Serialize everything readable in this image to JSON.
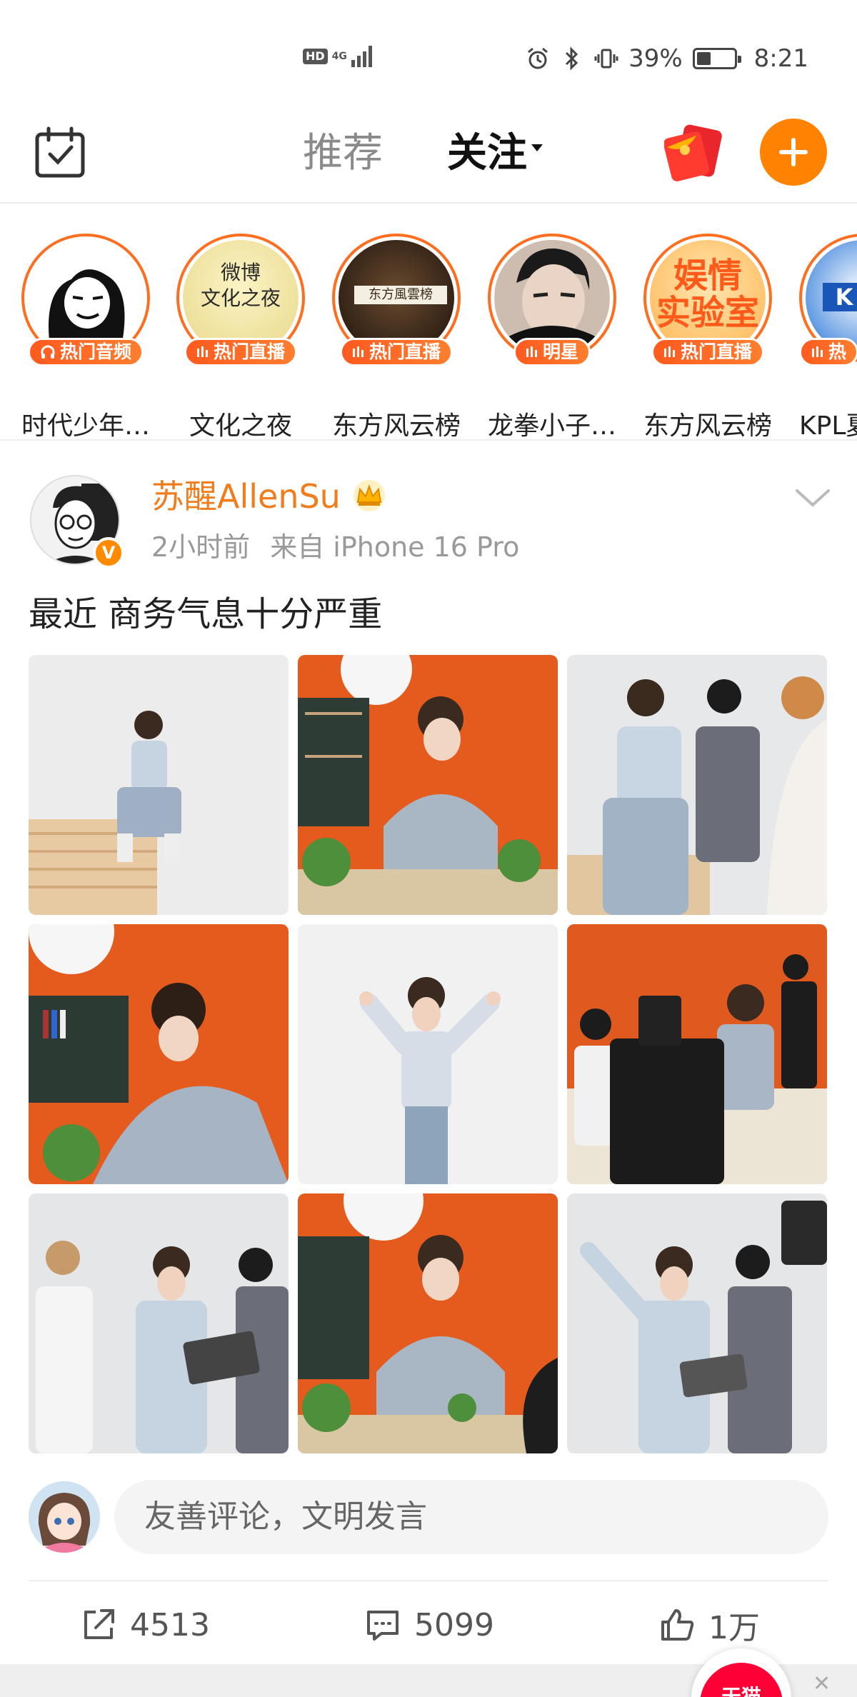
{
  "status_bar": {
    "hd": "HD",
    "network": "4G",
    "battery": "39%",
    "battery_level": 0.39,
    "time": "8:21"
  },
  "nav": {
    "tab_recommend": "推荐",
    "tab_follow": "关注",
    "active_tab": "关注",
    "accent_color": "#ff8200"
  },
  "live_strip": {
    "items": [
      {
        "badge": "热门音频",
        "name": "时代少年…",
        "badge_icon": "headphone-icon"
      },
      {
        "badge": "热门直播",
        "name": "文化之夜",
        "badge_icon": "live-bars-icon",
        "cover_text": "微博\n文化之夜"
      },
      {
        "badge": "热门直播",
        "name": "东方风云榜",
        "badge_icon": "live-bars-icon",
        "cover_text": "东方風雲榜"
      },
      {
        "badge": "明星",
        "name": "龙拳小子…",
        "badge_icon": "live-bars-icon"
      },
      {
        "badge": "热门直播",
        "name": "东方风云榜",
        "badge_icon": "live-bars-icon",
        "cover_text": "娱情\n实验室"
      },
      {
        "badge": "热",
        "name": "KPL夏",
        "badge_icon": "live-bars-icon",
        "cover_text": "K"
      }
    ]
  },
  "post": {
    "author": "苏醒AllenSu",
    "time": "2小时前",
    "source": "来自 iPhone 16 Pro",
    "text": "最近 商务气息十分严重",
    "photos": [
      {
        "scene": "white-studio-stairs"
      },
      {
        "scene": "orange-office-desk"
      },
      {
        "scene": "studio-crew"
      },
      {
        "scene": "orange-office-writing"
      },
      {
        "scene": "white-thumbs-up"
      },
      {
        "scene": "office-camera"
      },
      {
        "scene": "studio-makeup"
      },
      {
        "scene": "orange-office-desk"
      },
      {
        "scene": "studio-pointing"
      }
    ]
  },
  "comment": {
    "placeholder": "友善评论，文明发言"
  },
  "actions": {
    "share_count": "4513",
    "comment_count": "5099",
    "like_count": "1万"
  },
  "ad": {
    "label": "天猫"
  }
}
